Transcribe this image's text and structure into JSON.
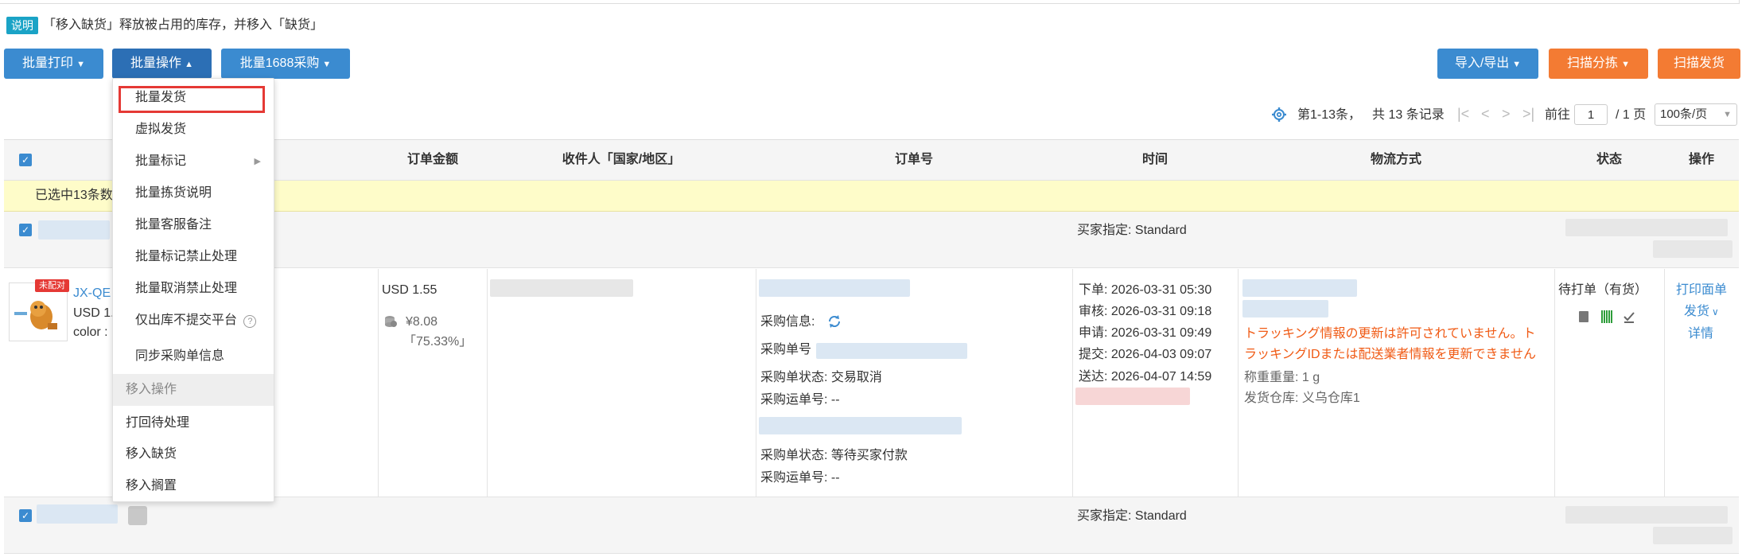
{
  "tip": {
    "tag": "说明",
    "text": "「移入缺货」释放被占用的库存，并移入「缺货」"
  },
  "toolbar": {
    "batch_print": "批量打印",
    "batch_ops": "批量操作",
    "batch_1688": "批量1688采购",
    "import_export": "导入/导出",
    "scan_sort": "扫描分拣",
    "scan_ship": "扫描发货"
  },
  "pager": {
    "range": "第1-13条，",
    "total": "共 13 条记录",
    "goto": "前往",
    "page_value": "1",
    "page_total": "/ 1 页",
    "page_size": "100条/页"
  },
  "table": {
    "headers": {
      "amount": "订单金额",
      "recipient": "收件人「国家/地区」",
      "order_no": "订单号",
      "time": "时间",
      "logistics": "物流方式",
      "status": "状态",
      "actions": "操作"
    },
    "selected_text": "已选中13条数",
    "group1": {
      "buyer_spec": "买家指定:  Standard"
    },
    "group2": {
      "buyer_spec": "买家指定:  Standard"
    },
    "order": {
      "badge": "未配对",
      "sku": "JX-QE",
      "price_line": "USD 1.",
      "attr": "color  :",
      "amount": "USD 1.55",
      "cost": "¥8.08",
      "ratio": "「75.33%」",
      "purchase_info": "采购信息:",
      "purchase_no": "采购单号",
      "purchase_status1": "采购单状态:  交易取消",
      "tracking1": "采购运单号:  --",
      "purchase_status2": "采购单状态:  等待买家付款",
      "tracking2": "采购运单号:  --",
      "times": [
        "下单:  2026-03-31 05:30",
        "审核:  2026-03-31 09:18",
        "申请:  2026-03-31 09:49",
        "提交:  2026-04-03 09:07",
        "送达:  2026-04-07 14:59"
      ],
      "logistics_err_line1": "トラッキング情報の更新は許可されていません。ト",
      "logistics_err_line2": "ラッキングIDまたは配送業者情報を更新できません",
      "weight": "称重重量:  1 g",
      "warehouse": "发货仓库:  义乌仓库1",
      "status": "待打单（有货）",
      "action_print": "打印面单",
      "action_ship": "发货",
      "action_detail": "详情"
    }
  },
  "menu": {
    "items": [
      "批量发货",
      "虚拟发货",
      "批量标记",
      "批量拣货说明",
      "批量客服备注",
      "批量标记禁止处理",
      "批量取消禁止处理",
      "仅出库不提交平台",
      "同步采购单信息"
    ],
    "group_label": "移入操作",
    "group_items": [
      "打回待处理",
      "移入缺货",
      "移入搁置"
    ]
  },
  "colors": {
    "primary": "#3b8bd0",
    "orange": "#f37b33",
    "highlight": "#e53935",
    "error": "#f05a14",
    "selected_bg": "#fefcc9"
  }
}
